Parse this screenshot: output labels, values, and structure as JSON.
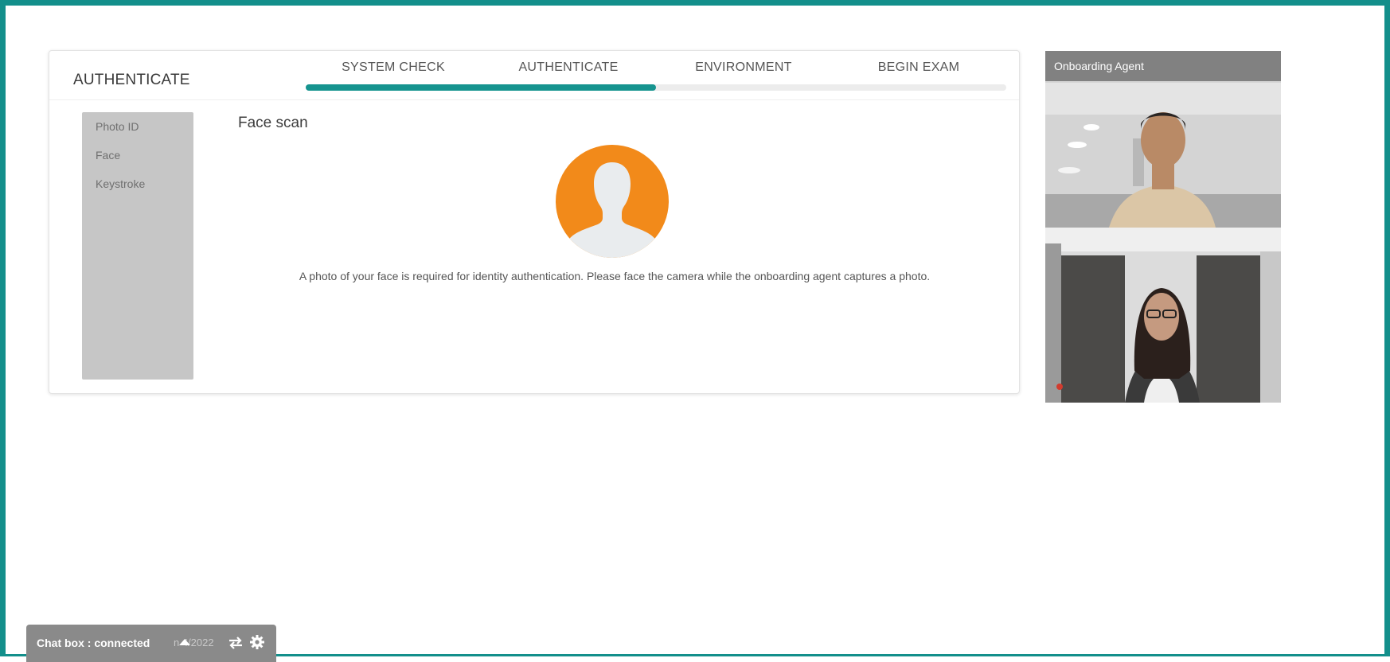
{
  "header": {
    "title": "AUTHENTICATE",
    "steps": [
      {
        "label": "SYSTEM CHECK"
      },
      {
        "label": "AUTHENTICATE"
      },
      {
        "label": "ENVIRONMENT"
      },
      {
        "label": "BEGIN EXAM"
      }
    ],
    "progress_fraction": 0.5,
    "accent_color": "#16948f"
  },
  "sidebar": {
    "items": [
      {
        "label": "Photo ID"
      },
      {
        "label": "Face"
      },
      {
        "label": "Keystroke"
      }
    ]
  },
  "main": {
    "section_title": "Face scan",
    "avatar_icon": "user-silhouette-icon",
    "avatar_color": "#f28a1a",
    "instructions": "A photo of your face is required for identity authentication. Please face the camera while the onboarding agent captures a photo."
  },
  "video": {
    "agent_label": "Onboarding Agent"
  },
  "chatbox": {
    "status": "Chat box : connected",
    "ghost_text": "n 4/2022"
  }
}
